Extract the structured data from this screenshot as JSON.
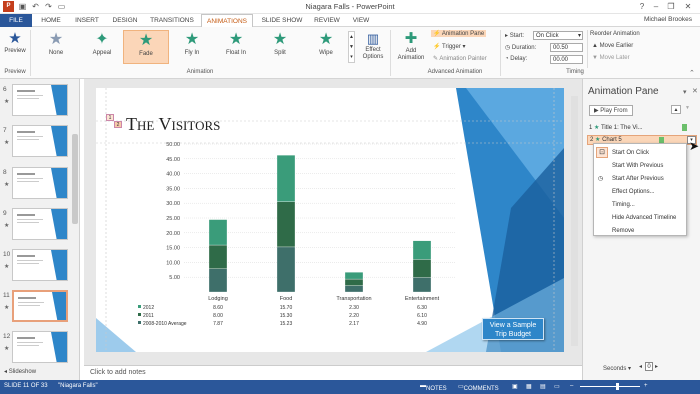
{
  "window": {
    "title": "Niagara Falls - PowerPoint",
    "user": "Michael Brookes"
  },
  "qat": {
    "icons": [
      "powerpoint-icon",
      "save-icon",
      "undo-icon",
      "redo-icon",
      "present-icon"
    ]
  },
  "tabs": [
    "FILE",
    "HOME",
    "INSERT",
    "DESIGN",
    "TRANSITIONS",
    "ANIMATIONS",
    "SLIDE SHOW",
    "REVIEW",
    "VIEW"
  ],
  "active_tab": "ANIMATIONS",
  "ribbon": {
    "preview": {
      "label": "Preview",
      "group": "Preview"
    },
    "animations": [
      "None",
      "Appeal",
      "Fade",
      "Fly In",
      "Float In",
      "Split",
      "Wipe"
    ],
    "selected_animation": "Fade",
    "effect_options": "Effect Options",
    "group_animation": "Animation",
    "add_animation": "Add Animation",
    "animation_pane": "Animation Pane",
    "trigger": "Trigger",
    "animation_painter": "Animation Painter",
    "group_advanced": "Advanced Animation",
    "start_label": "Start:",
    "start_value": "On Click",
    "duration_label": "Duration:",
    "duration_value": "00.50",
    "delay_label": "Delay:",
    "delay_value": "00.00",
    "reorder": "Reorder Animation",
    "move_earlier": "Move Earlier",
    "move_later": "Move Later",
    "group_timing": "Timing"
  },
  "thumbnails": [
    "6",
    "7",
    "8",
    "9",
    "10",
    "11",
    "12"
  ],
  "selected_slide": "11",
  "thumb_tab": "Slideshow",
  "slide": {
    "title": "The Visitors",
    "markers": [
      "1",
      "2"
    ],
    "button_line1": "View a Sample",
    "button_line2": "Trip Budget",
    "table": {
      "rows": [
        {
          "label": "2012",
          "values": [
            "8.60",
            "15.70",
            "2.30",
            "6.30"
          ]
        },
        {
          "label": "2011",
          "values": [
            "8.00",
            "15.30",
            "2.20",
            "6.10"
          ]
        },
        {
          "label": "2008-2010 Average",
          "values": [
            "7.87",
            "15.23",
            "2.17",
            "4.90"
          ]
        }
      ]
    }
  },
  "chart_data": {
    "type": "bar",
    "stacked": true,
    "categories": [
      "Lodging",
      "Food",
      "Transportation",
      "Entertainment"
    ],
    "series": [
      {
        "name": "2008-2010 Average",
        "values": [
          7.87,
          15.23,
          2.17,
          4.9
        ],
        "color": "#3e6f6a"
      },
      {
        "name": "2011",
        "values": [
          8.0,
          15.3,
          2.2,
          6.1
        ],
        "color": "#2f6b48"
      },
      {
        "name": "2012",
        "values": [
          8.6,
          15.7,
          2.3,
          6.3
        ],
        "color": "#3a9c7a"
      }
    ],
    "yticks": [
      "5.00",
      "10.00",
      "15.00",
      "20.00",
      "25.00",
      "30.00",
      "35.00",
      "40.00",
      "45.00",
      "50.00"
    ],
    "ylim": [
      0,
      50
    ]
  },
  "pane": {
    "title": "Animation Pane",
    "play_from": "Play From",
    "items": [
      {
        "num": "1",
        "label": "Title 1: The Vi..."
      },
      {
        "num": "2",
        "label": "Chart 5"
      }
    ],
    "menu": [
      "Start On Click",
      "Start With Previous",
      "Start After Previous",
      "Effect Options...",
      "Timing...",
      "Hide Advanced Timeline",
      "Remove"
    ],
    "seconds": "Seconds",
    "seconds_value": "0"
  },
  "notes": "Click to add notes",
  "status": {
    "slide": "SLIDE 11 OF 33",
    "theme": "\"Niagara Falls\"",
    "notes": "NOTES",
    "comments": "COMMENTS"
  },
  "colors": {
    "accent": "#c55a11",
    "file_tab": "#2b579a",
    "status": "#2b579a",
    "slide_blue": "#2e86c9"
  }
}
